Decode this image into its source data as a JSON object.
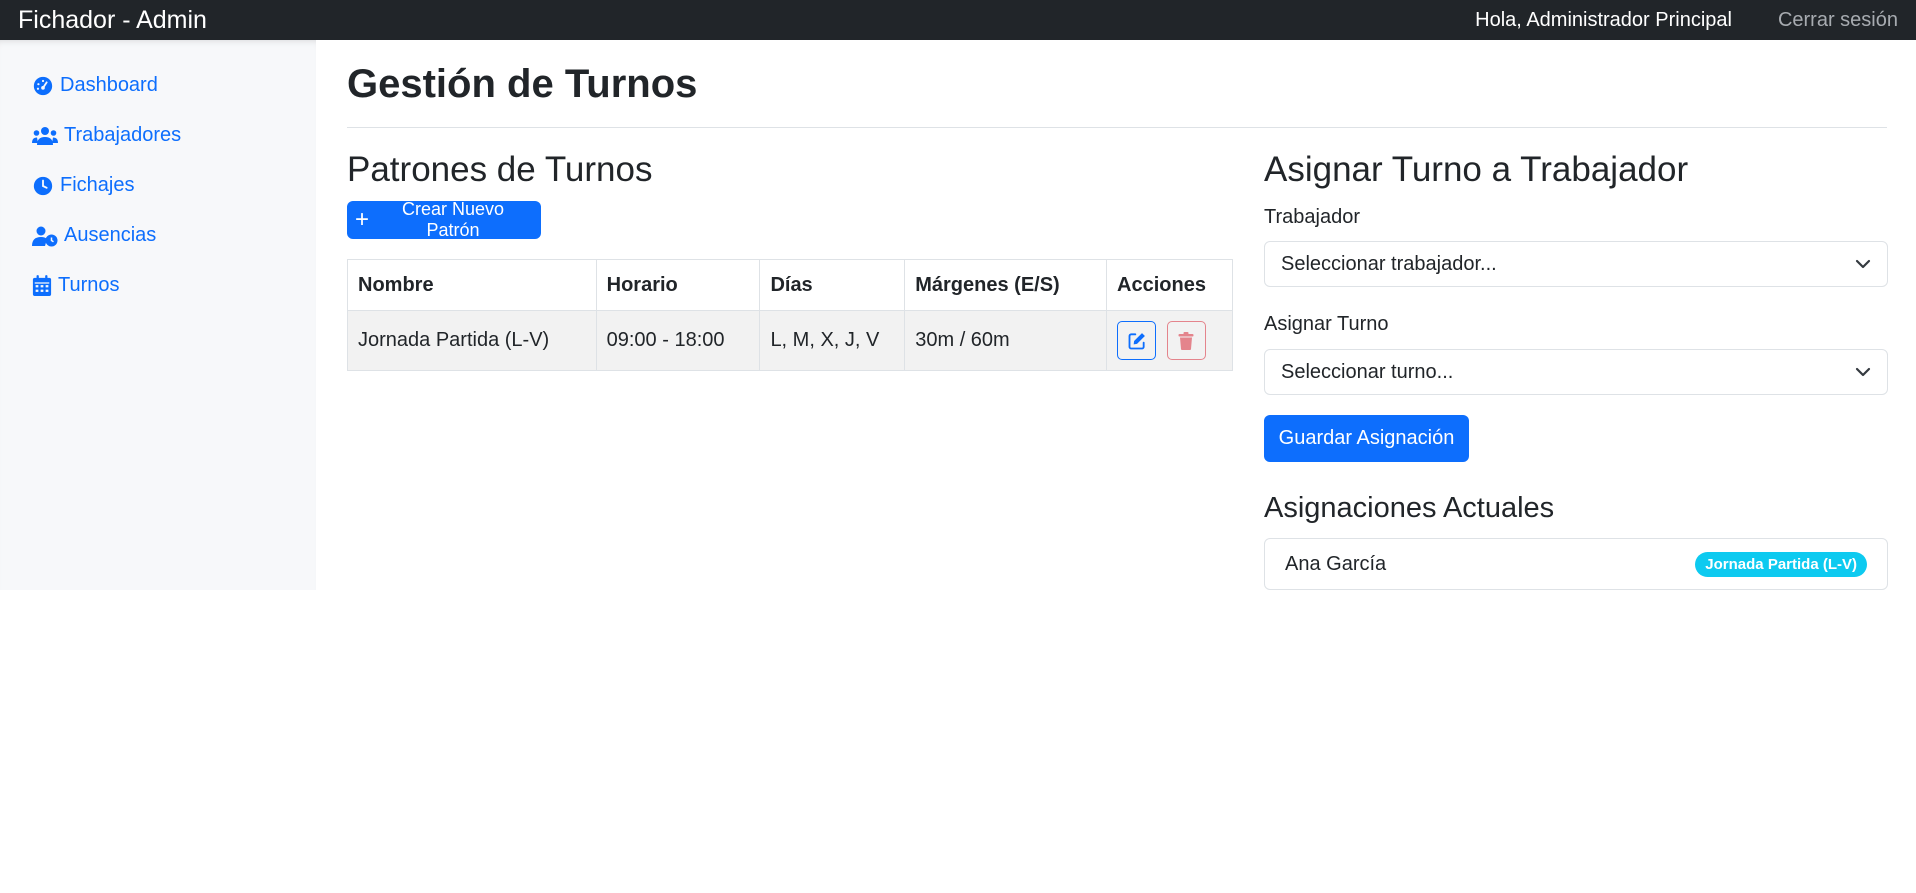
{
  "app": {
    "brand": "Fichador - Admin",
    "greeting": "Hola, Administrador Principal",
    "logout": "Cerrar sesión"
  },
  "sidebar": {
    "items": [
      {
        "label": "Dashboard",
        "icon": "gauge-icon"
      },
      {
        "label": "Trabajadores",
        "icon": "users-icon"
      },
      {
        "label": "Fichajes",
        "icon": "clock-icon"
      },
      {
        "label": "Ausencias",
        "icon": "user-clock-icon"
      },
      {
        "label": "Turnos",
        "icon": "calendar-icon"
      }
    ]
  },
  "page": {
    "title": "Gestión de Turnos"
  },
  "patterns": {
    "heading": "Patrones de Turnos",
    "create_label": "Crear Nuevo Patrón",
    "columns": [
      "Nombre",
      "Horario",
      "Días",
      "Márgenes (E/S)",
      "Acciones"
    ],
    "rows": [
      {
        "nombre": "Jornada Partida (L-V)",
        "horario": "09:00 - 18:00",
        "dias": "L, M, X, J, V",
        "margenes": "30m / 60m"
      }
    ]
  },
  "assign": {
    "heading": "Asignar Turno a Trabajador",
    "worker_label": "Trabajador",
    "worker_selected": "Seleccionar trabajador...",
    "shift_label": "Asignar Turno",
    "shift_selected": "Seleccionar turno...",
    "save_label": "Guardar Asignación"
  },
  "current": {
    "heading": "Asignaciones Actuales",
    "items": [
      {
        "name": "Ana García",
        "badge": "Jornada Partida (L-V)"
      }
    ]
  },
  "colors": {
    "primary": "#0d6efd",
    "navbar": "#212529",
    "danger_outline": "#dc3545",
    "badge_info": "#0dcaf0"
  }
}
